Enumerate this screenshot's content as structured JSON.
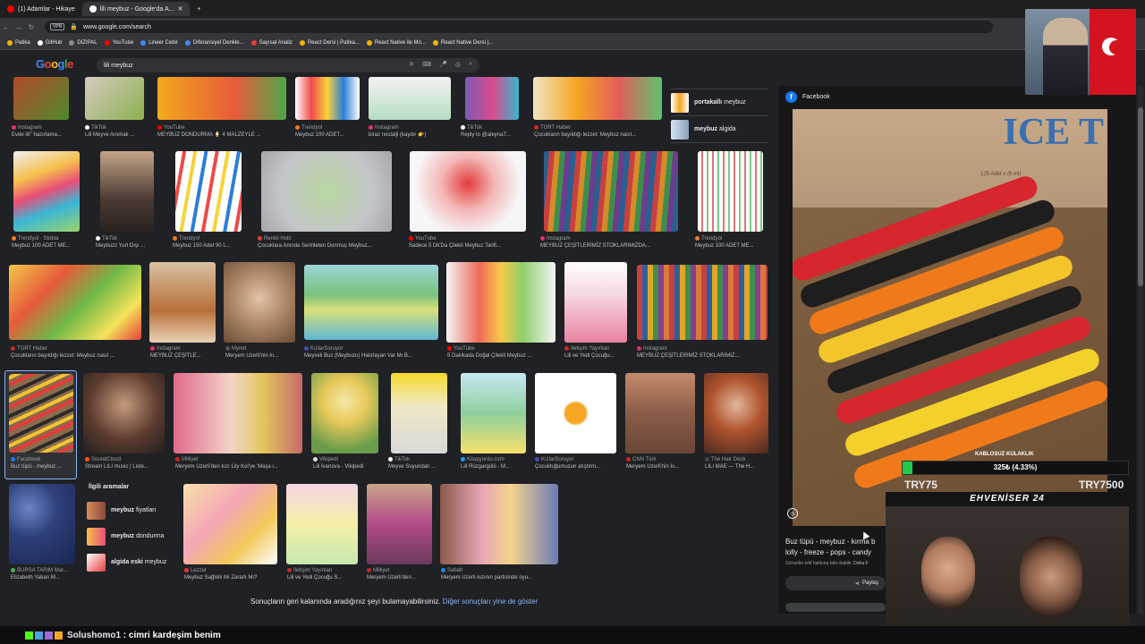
{
  "browser": {
    "tabs": [
      {
        "label": "(1) Adamlar - Hikaye",
        "active": false
      },
      {
        "label": "lili meybuz - Google'da A...",
        "active": true
      }
    ],
    "url": "www.google.com/search",
    "vpn_label": "VPN",
    "bookmarks": [
      "Patika",
      "GitHub",
      "DIZIPAL",
      "YouTube",
      "Lineer Cebir",
      "Diferansiyel Denkle...",
      "Sayısal Analiz",
      "React Dersi | Patika...",
      "React Native ile Mo...",
      "React Native Dersi |..."
    ]
  },
  "search": {
    "logo": "Google",
    "query": "lili meybuz"
  },
  "results": {
    "row1": [
      {
        "source": "Instagram",
        "title": "Evde lili\" hazırlama..."
      },
      {
        "source": "TikTok",
        "title": "Lili Meyve Aromalı ..."
      },
      {
        "source": "YouTube",
        "title": "MEYBUZ DONDURMA 🍦 4 MALZEYLE ..."
      },
      {
        "source": "Trendyol",
        "title": "Meybuz 100 ADET..."
      },
      {
        "source": "Instagram",
        "title": "biraz nostalji (kaydır 👉)"
      },
      {
        "source": "TikTok",
        "title": "Reply to @aleyna7..."
      },
      {
        "source": "TGRT Haber",
        "title": "Çocukların bayıldığı lezzet: Meybuz nasıl..."
      }
    ],
    "row2": [
      {
        "source": "Trendyol · Stokta",
        "title": "Meybuz 100 ADET ME..."
      },
      {
        "source": "TikTok",
        "title": "Meybuzz Yurt Dışı ..."
      },
      {
        "source": "Trendyol",
        "title": "Meybuz 150 Adet 90 L..."
      },
      {
        "source": "Renkli Hobi",
        "title": "Çocuklara Anında Serinleten Donmuş Meybuz..."
      },
      {
        "source": "YouTube",
        "title": "Sadece 5 Dk'Da Çilekli Meybuz Tarifi..."
      },
      {
        "source": "Instagram",
        "title": "MEYBUZ ÇEŞİTLERİMİZ STOKLARIMIZDA..."
      },
      {
        "source": "Trendyol",
        "title": "Meybuz 100 ADET ME..."
      }
    ],
    "row3": [
      {
        "source": "TGRT Haber",
        "title": "Çocukların bayıldığı lezzet: Meybuz nasıl ..."
      },
      {
        "source": "Instagram",
        "title": "MEYBUZ ÇEŞİTLE..."
      },
      {
        "source": "Mynet",
        "title": "Meryem Uzerli'nin kı..."
      },
      {
        "source": "KızlarSoruyor",
        "title": "Meyveli Buz (Meybuzu) Hatırlayan Var Mı B..."
      },
      {
        "source": "YouTube",
        "title": "5 Dakikada Doğal Çilekli Meybuz ..."
      },
      {
        "source": "İletişim Yayınları",
        "title": "Lili ve Yedi Çocuğu..."
      },
      {
        "source": "Instagram",
        "title": "MEYBUZ ÇEŞİTLERİMİZ STOKLARIMIZ..."
      }
    ],
    "row4": [
      {
        "source": "Facebook",
        "title": "Buz tüpü - meybuz ..."
      },
      {
        "source": "SoundCloud",
        "title": "Stream LILI music | Liste..."
      },
      {
        "source": "Milliyet",
        "title": "Meryem Uzerli'den kızı Lily Kol'ye 'Maşa i..."
      },
      {
        "source": "Vikipedi",
        "title": "Lili İvanova - Vikipedi"
      },
      {
        "source": "TikTok",
        "title": "Meyve Suyundan ..."
      },
      {
        "source": "Kitapyurdu.com",
        "title": "Lili Rüzgargülü - M..."
      },
      {
        "source": "KızlarSoruyor",
        "title": "Çocukluğumuzun atıştırm..."
      },
      {
        "source": "CNN Türk",
        "title": "Meryem Uzerli'nin kı..."
      },
      {
        "source": "The Hair Desk",
        "title": "LILI MAE — The H..."
      }
    ],
    "row5": [
      {
        "source": "BURSA TARIM Mar...",
        "title": "Elizabeth Yaban M..."
      },
      {
        "source": "Lezzet",
        "title": "Meybuz Sağlıklı Mı Zararlı Mı?"
      },
      {
        "source": "İletişim Yayınları",
        "title": "Lili ve Yedi Çocuğu S..."
      },
      {
        "source": "Milliyet",
        "title": "Meryem Uzerli'den..."
      },
      {
        "source": "Sabah",
        "title": "Meryem Uzerli kızının partisinde oyu..."
      }
    ],
    "related": {
      "header": "İlgili aramalar",
      "items": [
        {
          "bold": "meybuz",
          "rest": " fiyatları",
          "prefix": ""
        },
        {
          "bold": "meybuz",
          "rest": " dondurma",
          "prefix": ""
        },
        {
          "bold": "",
          "rest": " meybuz",
          "prefix": "algida eski"
        }
      ]
    },
    "side_chips": [
      {
        "label_bold": "portakallı",
        "label_rest": " meybuz"
      },
      {
        "label_bold": "meybuz",
        "label_rest": " algida"
      }
    ],
    "bottom_message": "Sonuçların geri kalanında aradığınız şeyi bulamayabilirsiniz.",
    "bottom_link": "Diğer sonuçları yine de göster"
  },
  "panel": {
    "source": "Facebook",
    "box_brand": "ICE T",
    "box_sub": "125 Adet x (6 ml)",
    "title_line1": "Buz tüpü - meybuz - kırma b",
    "title_line2": "lolly - freeze - pops - candy",
    "note": "Görseller telif hakkına tabi olabilir.",
    "note_more": "Daha F",
    "share_label": "Paylaş"
  },
  "stream_overlay": {
    "product_title": "KABLOSUZ KULAKLIK",
    "price_text": "325₺ (4.33%)",
    "progress": 0.0433,
    "try_left": "TRY75",
    "try_right": "TRY7500",
    "webcam_label": "EHVENİSER 24"
  },
  "chat": {
    "username": "Solushomo1",
    "separator": " : ",
    "message": "cimri kardeşim benim"
  }
}
